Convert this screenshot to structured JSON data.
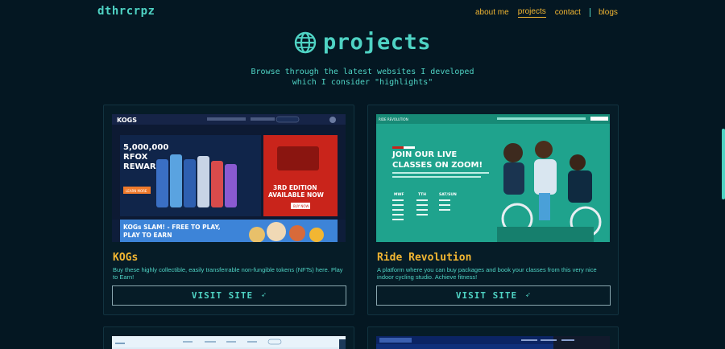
{
  "nav": {
    "logo": "dthrcrpz",
    "links": [
      "about me",
      "projects",
      "contact"
    ],
    "blogs": "blogs"
  },
  "header": {
    "title": "projects",
    "subtitle_line1": "Browse through the latest websites I developed",
    "subtitle_line2": "which I consider \"highlights\""
  },
  "projects": [
    {
      "title": "KOGs",
      "description": "Buy these highly collectible, easily transferrable non-fungible tokens (NFTs) here. Play to Earn!",
      "button": "VISIT SITE",
      "preview": {
        "brand": "KOGS",
        "headline_1": "5,000,000",
        "headline_2": "RFOX",
        "headline_3": "REWARDS",
        "badge_1": "3RD EDITION",
        "badge_2": "AVAILABLE NOW",
        "cta": "LEARN MORE",
        "buy": "BUY NOW",
        "banner_1": "KOGs SLAM! - FREE TO PLAY,",
        "banner_2": "PLAY TO EARN"
      }
    },
    {
      "title": "Ride Revolution",
      "description": "A platform where you can buy packages and book your classes from this very nice indoor cycling studio. Achieve fitness!",
      "button": "VISIT SITE",
      "preview": {
        "brand": "RIDE REVOLUTION",
        "headline_1": "JOIN OUR LIVE",
        "headline_2": "CLASSES ON ZOOM!",
        "col_1": "MWF",
        "col_2": "TTH",
        "col_3": "SAT/SUN"
      }
    }
  ],
  "colors": {
    "background": "#041722",
    "accent": "#4fd3c4",
    "highlight": "#f2b632"
  }
}
